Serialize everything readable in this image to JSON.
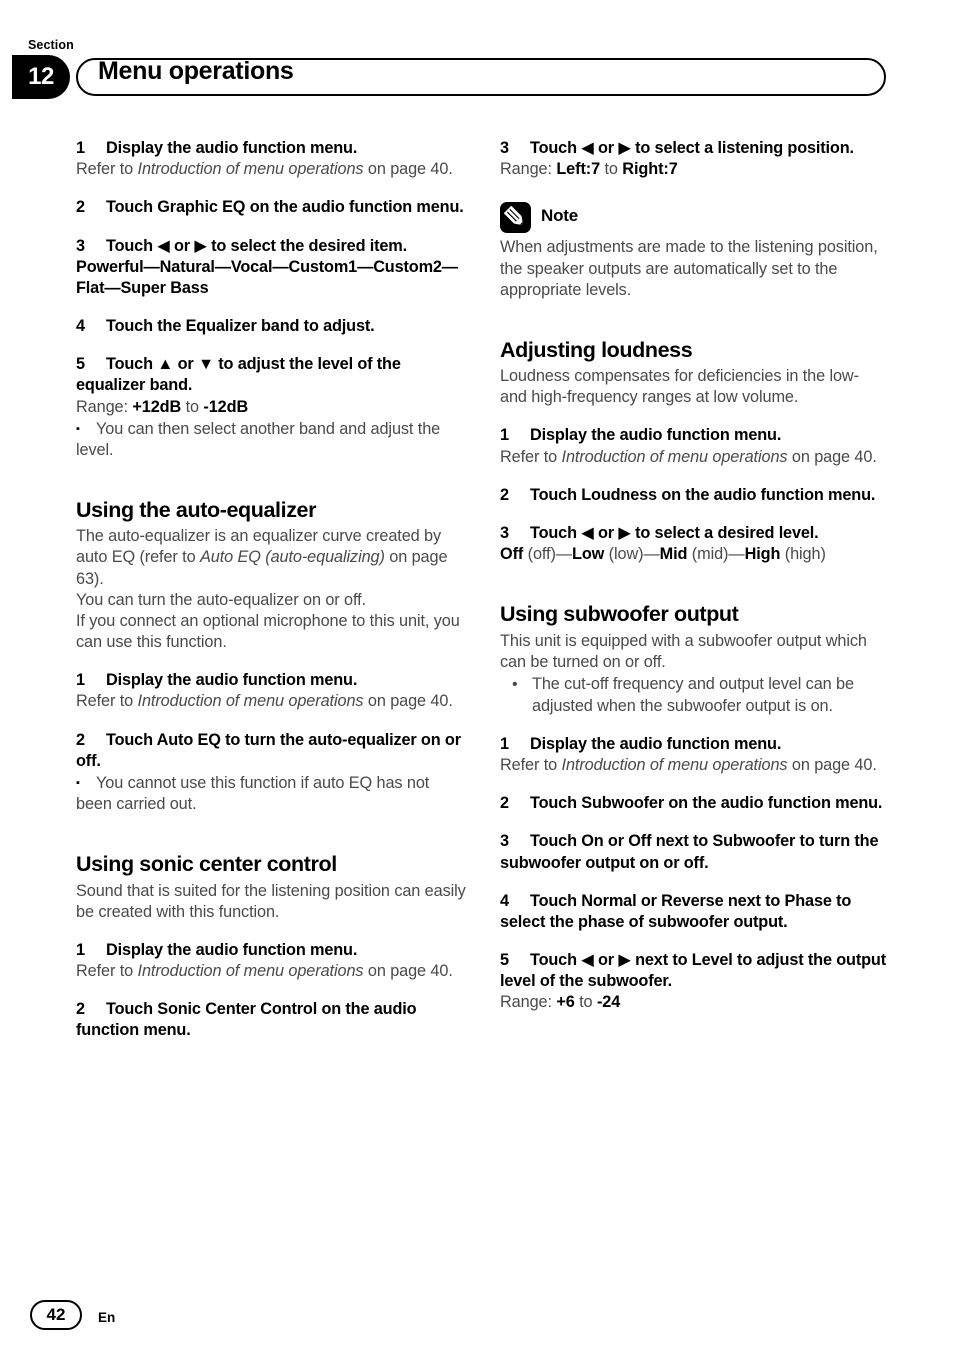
{
  "header": {
    "section_word": "Section",
    "section_number": "12",
    "title": "Menu operations"
  },
  "footer": {
    "page_number": "42",
    "language": "En"
  },
  "note": {
    "icon": "pencil-icon",
    "label": "Note",
    "body": "When adjustments are made to the listening position, the speaker outputs are automatically set to the appropriate levels."
  },
  "left_column": {
    "step1_num": "1",
    "step1_text": "Display the audio function menu.",
    "step1_ref_pre": "Refer to ",
    "step1_ref_italic": "Introduction of menu operations",
    "step1_ref_post": " on page 40.",
    "step2_num": "2",
    "step2_text": "Touch Graphic EQ on the audio function menu.",
    "step3_num": "3",
    "step3_text": "Touch ◀ or ▶ to select the desired item.",
    "step3_options": "Powerful—Natural—Vocal—Custom1—Custom2—Flat—Super Bass",
    "step4_num": "4",
    "step4_text": "Touch the Equalizer band to adjust.",
    "step5_num": "5",
    "step5_text": "Touch ▲ or ▼ to adjust the level of the equalizer band.",
    "step5_range_label": "Range: ",
    "step5_range_from": "+12dB",
    "step5_range_to_word": " to ",
    "step5_range_to": "-12dB",
    "step5_bullet": "You can then select another band and adjust the level.",
    "heading_auto_eq": "Using the auto-equalizer",
    "auto_eq_p1_a": "The auto-equalizer is an equalizer curve created by auto EQ (refer to ",
    "auto_eq_p1_italic": "Auto EQ (auto-equalizing)",
    "auto_eq_p1_b": " on page 63).",
    "auto_eq_p2": "You can turn the auto-equalizer on or off.",
    "auto_eq_p3": "If you connect an optional microphone to this unit, you can use this function.",
    "auto_eq_step1_num": "1",
    "auto_eq_step1_text": "Display the audio function menu.",
    "auto_eq_step2_num": "2",
    "auto_eq_step2_text": "Touch Auto EQ to turn the auto-equalizer on or off.",
    "auto_eq_step2_bullet": "You cannot use this function if auto EQ has not been carried out.",
    "heading_sonic": "Using sonic center control",
    "sonic_p1": "Sound that is suited for the listening position can easily be created with this function.",
    "sonic_step1_num": "1",
    "sonic_step1_text": "Display the audio function menu.",
    "sonic_step2_num": "2",
    "sonic_step2_text": "Touch Sonic Center Control on the audio function menu."
  },
  "right_column": {
    "step3_num": "3",
    "step3_text": "Touch ◀ or ▶ to select a listening position.",
    "step3_range_label": "Range: ",
    "step3_range_from": "Left:7",
    "step3_range_to_word": " to ",
    "step3_range_to": "Right:7",
    "heading_loudness": "Adjusting loudness",
    "loudness_p1": "Loudness compensates for deficiencies in the low- and high-frequency ranges at low volume.",
    "loudness_step1_num": "1",
    "loudness_step1_text": "Display the audio function menu.",
    "loudness_step2_num": "2",
    "loudness_step2_text": "Touch Loudness on the audio function menu.",
    "loudness_step3_num": "3",
    "loudness_step3_text": "Touch ◀ or ▶ to select a desired level.",
    "loudness_opt1_b": "Off",
    "loudness_opt1_n": " (off)—",
    "loudness_opt2_b": "Low",
    "loudness_opt2_n": " (low)—",
    "loudness_opt3_b": "Mid",
    "loudness_opt3_n": " (mid)—",
    "loudness_opt4_b": "High",
    "loudness_opt4_n": " (high)",
    "heading_subwoofer": "Using subwoofer output",
    "sub_p1": "This unit is equipped with a subwoofer output which can be turned on or off.",
    "sub_bullet1": "The cut-off frequency and output level can be adjusted when the subwoofer output is on.",
    "sub_step1_num": "1",
    "sub_step1_text": "Display the audio function menu.",
    "sub_step2_num": "2",
    "sub_step2_text": "Touch Subwoofer on the audio function menu.",
    "sub_step3_num": "3",
    "sub_step3_text": "Touch On or Off next to Subwoofer to turn the subwoofer output on or off.",
    "sub_step4_num": "4",
    "sub_step4_text": "Touch Normal or Reverse next to Phase to select the phase of subwoofer output.",
    "sub_step5_num": "5",
    "sub_step5_text": "Touch ◀ or ▶ next to Level to adjust the output level of the subwoofer.",
    "sub_step5_range_label": "Range: ",
    "sub_step5_range_from": "+6",
    "sub_step5_range_to_word": " to ",
    "sub_step5_range_to": "-24"
  },
  "shared": {
    "refer_pre": "Refer to ",
    "refer_italic": "Introduction of menu operations",
    "refer_post": " on page 40.",
    "square_bullet": "▪",
    "round_bullet": "•"
  }
}
